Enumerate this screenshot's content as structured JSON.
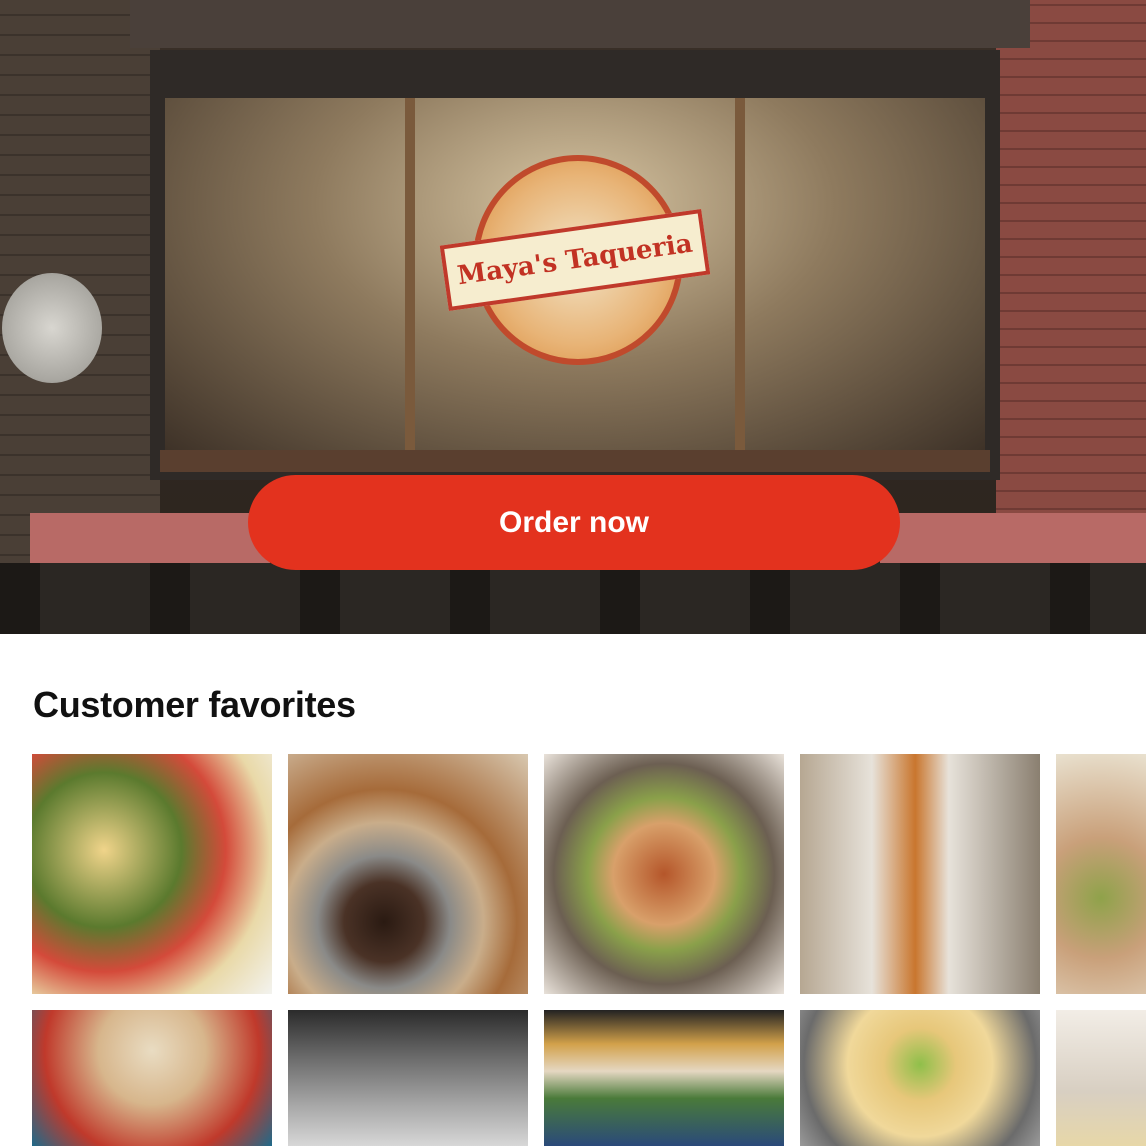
{
  "hero": {
    "logo_text": "Maya's Taqueria",
    "order_button_label": "Order now",
    "button_color": "#e3321e"
  },
  "section": {
    "title": "Customer favorites"
  },
  "favorites": [
    {
      "name": "Street tacos with cilantro and radish"
    },
    {
      "name": "Churros with chocolate dip"
    },
    {
      "name": "Chicken tacos with lime"
    },
    {
      "name": "Churro in paper wrap"
    },
    {
      "name": "Tacos with lime"
    },
    {
      "name": "Burrito with chicharron"
    },
    {
      "name": "Kitchen counter"
    },
    {
      "name": "Taco platter"
    },
    {
      "name": "Tacos with green salsa"
    },
    {
      "name": "Wrapped tortilla"
    }
  ]
}
